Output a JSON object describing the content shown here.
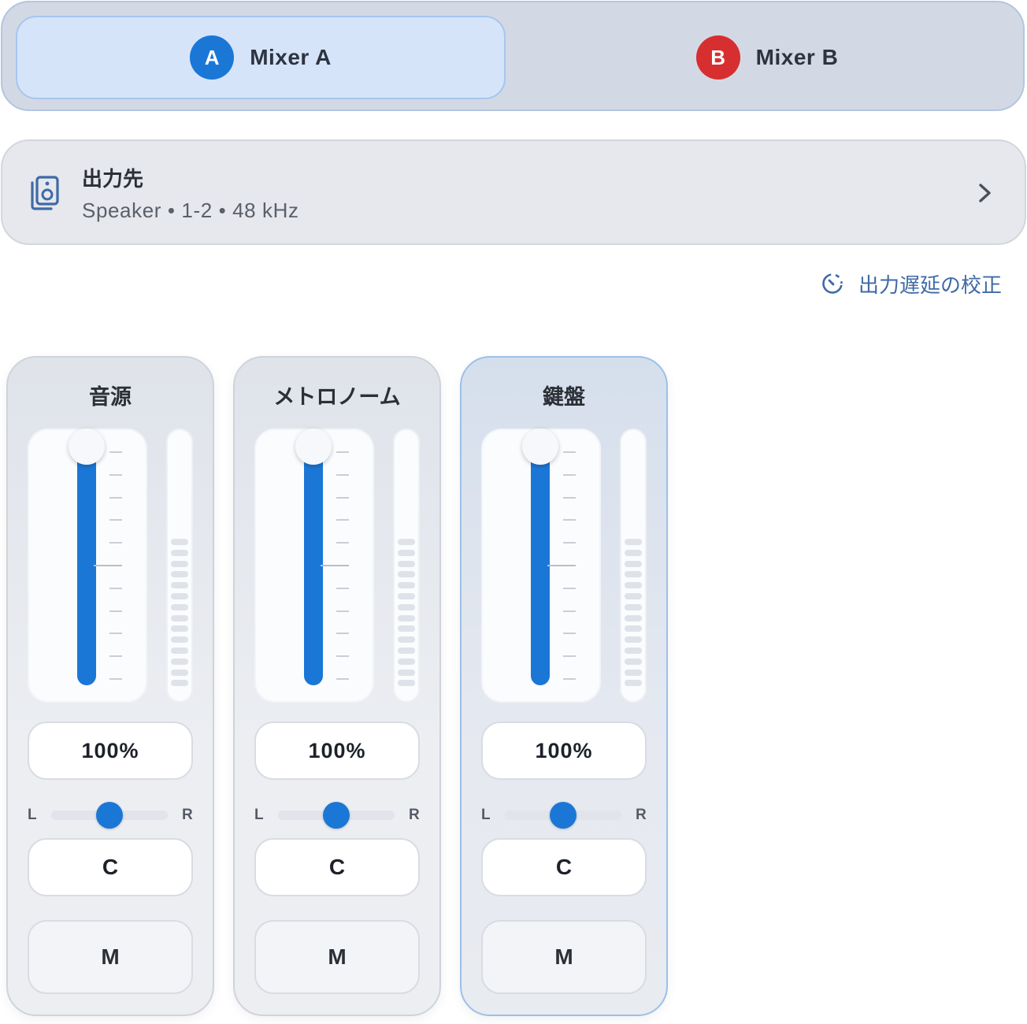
{
  "mixers": {
    "tabs": [
      {
        "badge": "A",
        "label": "Mixer A",
        "color": "#1b77d6",
        "active": true
      },
      {
        "badge": "B",
        "label": "Mixer B",
        "color": "#d72f2f",
        "active": false
      }
    ]
  },
  "output": {
    "title": "出力先",
    "subtitle": "Speaker • 1-2 • 48 kHz",
    "icon": "speaker-icon",
    "chevron": "chevron-right-icon"
  },
  "calibration": {
    "label": "出力遅延の校正",
    "icon": "timer-icon"
  },
  "channels": [
    {
      "name": "音源",
      "volume": "100%",
      "fader_level": 1.0,
      "pan_label_l": "L",
      "pan_label_r": "R",
      "pan_position": 0.5,
      "center_label": "C",
      "mute_label": "M",
      "selected": false
    },
    {
      "name": "メトロノーム",
      "volume": "100%",
      "fader_level": 1.0,
      "pan_label_l": "L",
      "pan_label_r": "R",
      "pan_position": 0.5,
      "center_label": "C",
      "mute_label": "M",
      "selected": false
    },
    {
      "name": "鍵盤",
      "volume": "100%",
      "fader_level": 1.0,
      "pan_label_l": "L",
      "pan_label_r": "R",
      "pan_position": 0.5,
      "center_label": "C",
      "mute_label": "M",
      "selected": true
    }
  ],
  "colors": {
    "accent": "#1b77d6",
    "accent_b": "#d72f2f",
    "link": "#3f6aa6"
  }
}
